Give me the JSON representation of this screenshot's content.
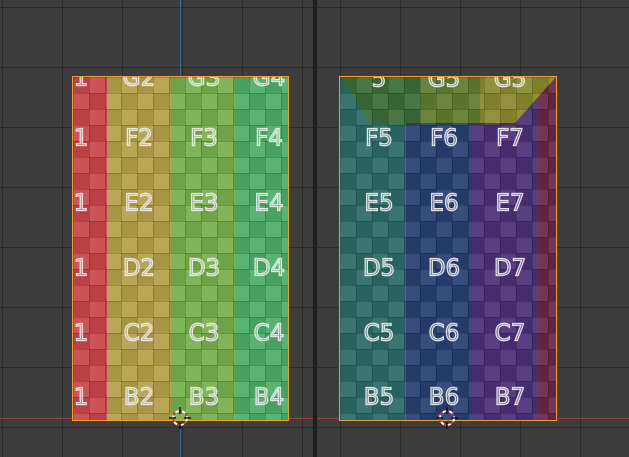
{
  "viewport_left": {
    "colors": [
      "#c8474a",
      "#b3a04a",
      "#76b04c",
      "#4cae68"
    ],
    "labels": [
      [
        "1",
        "G2",
        "G3",
        "G4"
      ],
      [
        "1",
        "F2",
        "F3",
        "F4"
      ],
      [
        "1",
        "E2",
        "E3",
        "E4"
      ],
      [
        "1",
        "D2",
        "D3",
        "D4"
      ],
      [
        "1",
        "C2",
        "C3",
        "C4"
      ],
      [
        "1",
        "B2",
        "B3",
        "B4"
      ]
    ]
  },
  "viewport_right": {
    "colors": [
      "#2c6a66",
      "#283f72",
      "#4c2f78",
      "#6a2748"
    ],
    "top_band_colors": [
      "#3c6d38",
      "#5f7c2e",
      "#8a8a2e"
    ],
    "labels": [
      [
        "5",
        "G5",
        "G5"
      ],
      [
        "F5",
        "F6",
        "F7"
      ],
      [
        "E5",
        "E6",
        "E7"
      ],
      [
        "D5",
        "D6",
        "D7"
      ],
      [
        "C5",
        "C6",
        "C7"
      ],
      [
        "B5",
        "B6",
        "B7"
      ]
    ]
  },
  "icons": {
    "cursor_left": "3d-cursor-icon",
    "cursor_right": "3d-cursor-icon"
  }
}
